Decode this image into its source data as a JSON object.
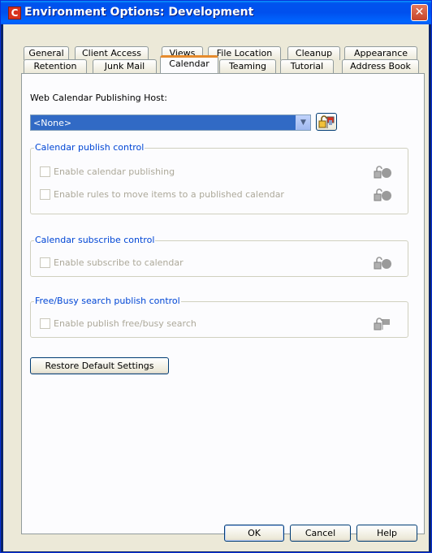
{
  "window": {
    "title": "Environment Options: Development",
    "close_glyph": "✕"
  },
  "tabs": {
    "row1": [
      "General",
      "Client Access",
      "Views",
      "File Location",
      "Cleanup",
      "Appearance"
    ],
    "row2": [
      "Retention",
      "Junk Mail",
      "Calendar",
      "Teaming",
      "Tutorial",
      "Address Book"
    ],
    "active": "Calendar"
  },
  "host": {
    "label": "Web Calendar Publishing Host:",
    "value": "<None>"
  },
  "publish_group": {
    "title": "Calendar publish control",
    "items": [
      "Enable calendar publishing",
      "Enable rules to move items to a published calendar"
    ]
  },
  "subscribe_group": {
    "title": "Calendar subscribe control",
    "items": [
      "Enable subscribe to calendar"
    ]
  },
  "freebusy_group": {
    "title": "Free/Busy search publish control",
    "items": [
      "Enable publish free/busy search"
    ]
  },
  "restore_label": "Restore Default Settings",
  "buttons": {
    "ok": "OK",
    "cancel": "Cancel",
    "help": "Help"
  },
  "colors": {
    "accent": "#0054e3",
    "selection": "#316ac5",
    "group_title": "#0046d5"
  }
}
